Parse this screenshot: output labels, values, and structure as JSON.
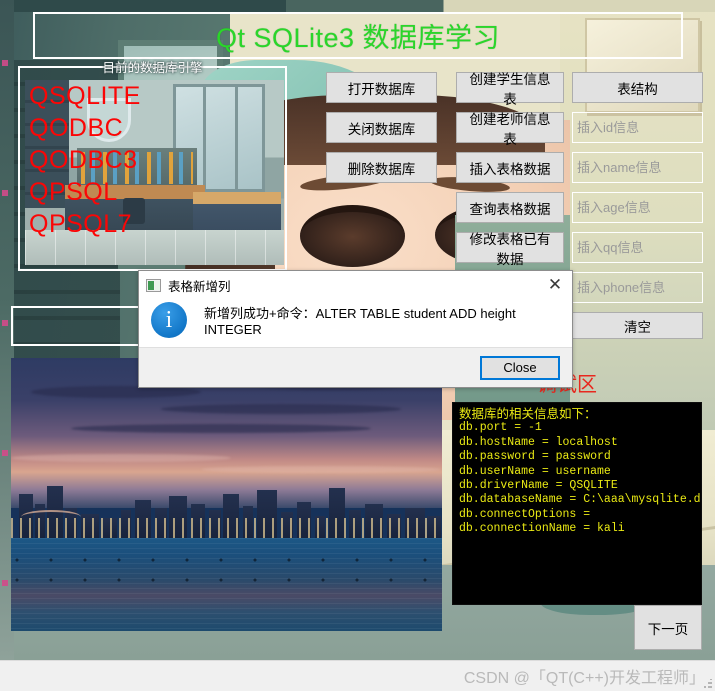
{
  "window": {
    "title_banner": "Qt SQLite3 数据库学习",
    "title_color": "#2ad62a"
  },
  "engine_group": {
    "title": "目前的数据库引擎",
    "items": [
      "QSQLITE",
      "QODBC",
      "QODBC3",
      "QPSQL",
      "QPSQL7"
    ],
    "item_color": "#fb0606"
  },
  "sql_box": {
    "value": "",
    "placeholder": ""
  },
  "buttons": {
    "open_db": "打开数据库",
    "close_db": "关闭数据库",
    "drop_db": "删除数据库",
    "create_student_table": "创建学生信息表",
    "create_teacher_table": "创建老师信息表",
    "insert_table_data": "插入表格数据",
    "query_table_data": "查询表格数据",
    "update_table_data": "修改表格已有数据",
    "table_schema": "表结构",
    "clear": "清空",
    "next_page": "下一页"
  },
  "inputs": [
    {
      "name": "id",
      "placeholder": "插入id信息",
      "value": ""
    },
    {
      "name": "name",
      "placeholder": "插入name信息",
      "value": ""
    },
    {
      "name": "age",
      "placeholder": "插入age信息",
      "value": ""
    },
    {
      "name": "qq",
      "placeholder": "插入qq信息",
      "value": ""
    },
    {
      "name": "phone",
      "placeholder": "插入phone信息",
      "value": ""
    }
  ],
  "debug": {
    "label": "调试区",
    "label_color": "#e8281e",
    "console_text_color": "#eaea14",
    "console_bg": "#000000",
    "lines": [
      "数据库的相关信息如下：",
      "db.port = -1",
      "db.hostName = localhost",
      "db.password = password",
      "db.userName = username",
      "db.driverName = QSQLITE",
      "db.databaseName = C:\\aaa\\mysqlite.db",
      "db.connectOptions = ",
      "db.connectionName = kali"
    ]
  },
  "dialog": {
    "title": "表格新增列",
    "icon": "app-icon",
    "close_x": "✕",
    "info_glyph": "i",
    "message": "新增列成功+命令：ALTER TABLE student ADD height INTEGER",
    "close_button": "Close",
    "focus_color": "#0078d7"
  },
  "statusbar": {
    "watermark": "CSDN @「QT(C++)开发工程师」"
  }
}
